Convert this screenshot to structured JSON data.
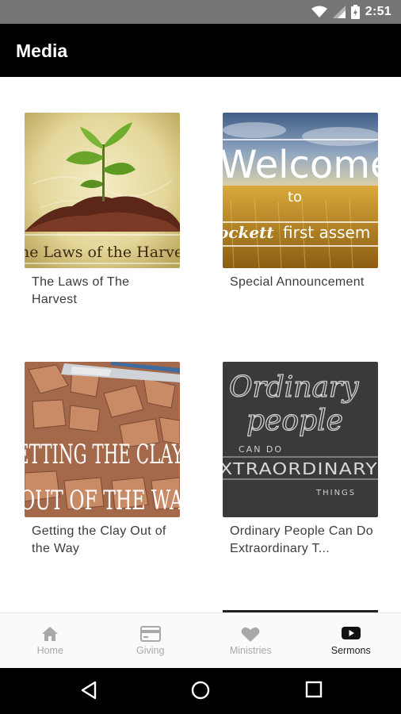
{
  "status_bar": {
    "time": "2:51"
  },
  "app_bar": {
    "title": "Media"
  },
  "media_items": [
    {
      "title": "The Laws of The Harvest",
      "thumb_text": "he Laws of the Harve"
    },
    {
      "title": "Special Announcement",
      "thumb_text": {
        "line1": "Welcome",
        "line2": "to",
        "line3a": "ockett",
        "line3b": "first assem"
      }
    },
    {
      "title": "Getting the Clay Out of the Way",
      "thumb_text": {
        "line1": "ETTING THE CLAY",
        "line2": "OUT OF THE WA"
      }
    },
    {
      "title": "Ordinary People Can Do Extraordinary T...",
      "thumb_text": {
        "line1": "Ordinary",
        "line2": "people",
        "line3": "CAN DO",
        "line4": "XTRAORDINARY",
        "line5": "THINGS"
      }
    }
  ],
  "bottom_nav": [
    {
      "label": "Home",
      "icon": "home-icon",
      "active": false
    },
    {
      "label": "Giving",
      "icon": "credit-card-icon",
      "active": false
    },
    {
      "label": "Ministries",
      "icon": "heart-icon",
      "active": false
    },
    {
      "label": "Sermons",
      "icon": "youtube-play-icon",
      "active": true
    }
  ],
  "colors": {
    "app_bar": "#000000",
    "status_bar": "#757575",
    "nav_active": "#222222",
    "nav_inactive": "#a9a9a9"
  }
}
